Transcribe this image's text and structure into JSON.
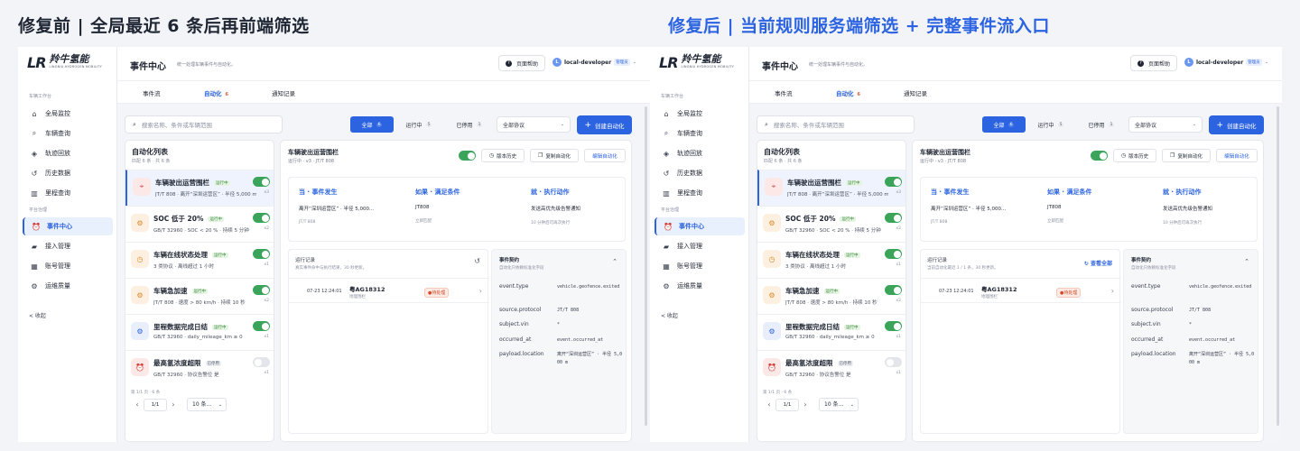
{
  "headlines": {
    "before": "修复前 | 全局最近 6 条后再前端筛选",
    "after": "修复后 | 当前规则服务端筛选 + 完整事件流入口"
  },
  "logo": {
    "mark": "LR",
    "cn": "羚牛氢能",
    "en": "LINGNIU HYDROGEN MOBILITY"
  },
  "sidebar": {
    "section_work": "车辆工作台",
    "section_platform": "平台治理",
    "items": [
      {
        "label": "全局监控",
        "icon": "home-icon"
      },
      {
        "label": "车辆查询",
        "icon": "search-icon"
      },
      {
        "label": "轨迹回放",
        "icon": "route-icon"
      },
      {
        "label": "历史数据",
        "icon": "history-icon"
      },
      {
        "label": "里程查询",
        "icon": "bar-chart-icon"
      },
      {
        "label": "事件中心",
        "icon": "alarm-clock-icon"
      },
      {
        "label": "接入管理",
        "icon": "plug-icon"
      },
      {
        "label": "账号管理",
        "icon": "users-icon"
      },
      {
        "label": "运维质量",
        "icon": "gear-icon"
      }
    ],
    "collapse_label": "< 收起"
  },
  "header": {
    "title": "事件中心",
    "subtitle": "统一处理车辆事件与自动化。",
    "help": "页面帮助",
    "user_initial": "L",
    "user": "local-developer",
    "role": "管理员"
  },
  "tabs": [
    {
      "label": "事件流",
      "count": ""
    },
    {
      "label": "自动化",
      "count": "6"
    },
    {
      "label": "通知记录",
      "count": ""
    }
  ],
  "toolbar": {
    "search_placeholder": "搜索名称、条件或车辆范围",
    "seg": [
      {
        "label": "全部",
        "count": "6"
      },
      {
        "label": "运行中",
        "count": "5"
      },
      {
        "label": "已停用",
        "count": "1"
      }
    ],
    "protocol": "全部协议",
    "create": "创建自动化"
  },
  "list": {
    "title": "自动化列表",
    "subtitle": "匹配 6 条 · 共 6 条",
    "rules": [
      {
        "name": "车辆驶出运营围栏",
        "status": "运行中",
        "desc": "JT/T 808 · 离开“深圳运营区” · 半径 5,000 m",
        "x": "x3",
        "on": true,
        "icon": "location-icon",
        "icon_bg": "#fde8e8",
        "icon_color": "#d24a4a"
      },
      {
        "name": "SOC 低于 20%",
        "status": "运行中",
        "desc": "GB/T 32960 · SOC < 20 % · 持续 5 分钟",
        "x": "x2",
        "on": true,
        "icon": "gear-icon",
        "icon_bg": "#fdf0e0",
        "icon_color": "#d8892a"
      },
      {
        "name": "车辆在线状态处理",
        "status": "运行中",
        "desc": "3 类协议 · 离线超过 1 小时",
        "x": "x1",
        "on": true,
        "icon": "clock-icon",
        "icon_bg": "#fdf0e0",
        "icon_color": "#d8892a"
      },
      {
        "name": "车辆急加速",
        "status": "运行中",
        "desc": "JT/T 808 · 速度 > 80 km/h · 持续 10 秒",
        "x": "x2",
        "on": true,
        "icon": "gear-icon",
        "icon_bg": "#fdf0e0",
        "icon_color": "#d8892a"
      },
      {
        "name": "里程数据完成日结",
        "status": "运行中",
        "desc": "GB/T 32960 · daily_mileage_km ≥ 0",
        "x": "x1",
        "on": true,
        "icon": "gear-icon",
        "icon_bg": "#e8eefc",
        "icon_color": "#2b63e0"
      },
      {
        "name": "最高氢浓度超限",
        "status": "已停用",
        "desc": "GB/T 32960 · 协议告警位 是",
        "x": "x1",
        "on": false,
        "icon": "alarm-clock-icon",
        "icon_bg": "#fde8e8",
        "icon_color": "#d24a4a"
      }
    ],
    "pager_info": "第 1/1 页 · 6 条",
    "page": "1/1",
    "page_size": "10 条..."
  },
  "detail": {
    "title": "车辆驶出运营围栏",
    "subtitle": "运行中 · v3 · JT/T 808",
    "btn_history": "版本历史",
    "btn_copy": "复制自动化",
    "btn_edit": "编辑自动化",
    "flow": [
      {
        "head": "当 · 事件发生",
        "value": "离开“深圳运营区” · 半径 5,000...",
        "sub": "JT/T 808"
      },
      {
        "head": "如果 · 满足条件",
        "value": "JT808",
        "sub": "立即匹配"
      },
      {
        "head": "就 · 执行动作",
        "value": "发送高优先级告警通知",
        "sub": "10 分钟后可再次执行"
      }
    ],
    "runlog_title": "运行记录",
    "runlog_sub_before": "真实事件命中与执行结果，30 秒更新。",
    "runlog_sub_after": "当前自动化最近 1 / 1 条，30 秒更新。",
    "view_all": "查看全部",
    "row": {
      "time": "07-23 12:24:01",
      "plate": "粤AG18312",
      "type": "地理围栏",
      "status": "●待处理"
    },
    "contract_title": "事件契约",
    "contract_sub": "自动化只依赖标准化字段",
    "fields": [
      {
        "k": "event.type",
        "v": "vehicle.geofence.exited"
      },
      {
        "k": "source.protocol",
        "v": "JT/T 808"
      },
      {
        "k": "subject.vin",
        "v": "*"
      },
      {
        "k": "occurred_at",
        "v": "event.occurred_at"
      },
      {
        "k": "payload.location",
        "v": "离开“深圳运营区” · 半径 5,000 m"
      }
    ]
  }
}
